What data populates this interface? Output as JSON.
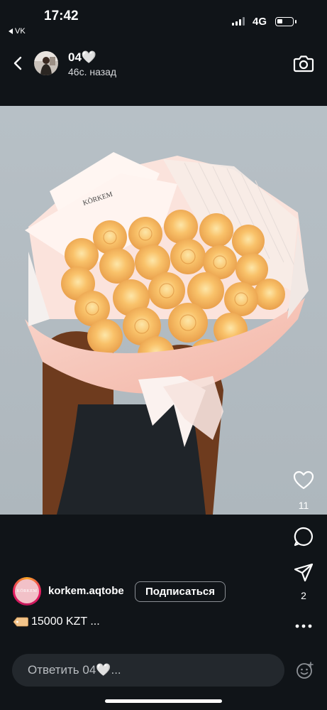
{
  "status_bar": {
    "time": "17:42",
    "back_app": "VK",
    "network": "4G"
  },
  "story": {
    "author_title": "04🤍",
    "time_ago": "46с. назад"
  },
  "photo": {
    "brand_on_wrap": "KÖRKEM"
  },
  "actions": {
    "likes": "11",
    "shares": "2"
  },
  "author": {
    "username": "korkem.aqtobe",
    "follow_label": "Подписаться",
    "avatar_logo": "KÖRKEM"
  },
  "caption": {
    "text": "15000 KZT ..."
  },
  "reply": {
    "placeholder": "Ответить 04🤍..."
  },
  "icons": {
    "back": "chevron-left-icon",
    "camera": "camera-icon",
    "like": "heart-icon",
    "comment": "comment-icon",
    "share": "paper-plane-icon",
    "more": "more-dots-icon",
    "emoji": "emoji-icon",
    "tag": "price-tag-icon"
  }
}
